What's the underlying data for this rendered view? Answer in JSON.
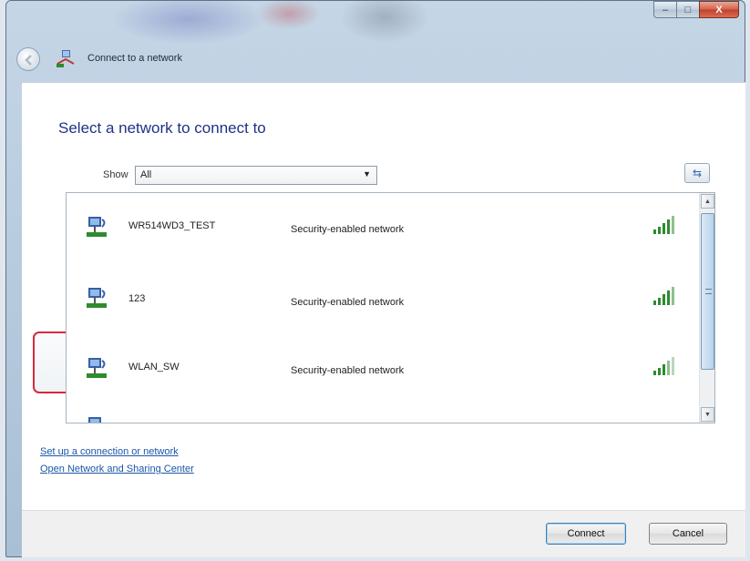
{
  "window": {
    "nav_title": "Connect to a network",
    "controls": {
      "minimize_glyph": "–",
      "maximize_glyph": "□",
      "close_glyph": "X"
    }
  },
  "main": {
    "heading": "Select a network to connect to",
    "show_label": "Show",
    "show_value": "All",
    "refresh_glyph": "⇆"
  },
  "networks": [
    {
      "name": "WR514WD3_TEST",
      "security": "Security-enabled network",
      "selected": false
    },
    {
      "name": "123",
      "security": "Security-enabled network",
      "selected": false
    },
    {
      "name": "WLAN_SW",
      "security": "Security-enabled network",
      "selected": true
    }
  ],
  "links": {
    "setup": "Set up a connection or network",
    "sharing": "Open Network and Sharing Center"
  },
  "buttons": {
    "connect": "Connect",
    "cancel": "Cancel"
  },
  "colors": {
    "heading": "#1e3287",
    "link": "#1b56a8",
    "selection_outline": "#d8293c",
    "signal_green": "#2e8b2e"
  },
  "icons": [
    "back-arrow-icon",
    "network-connect-icon",
    "wireless-network-icon",
    "signal-strength-icon",
    "refresh-icon",
    "dropdown-arrow-icon"
  ]
}
